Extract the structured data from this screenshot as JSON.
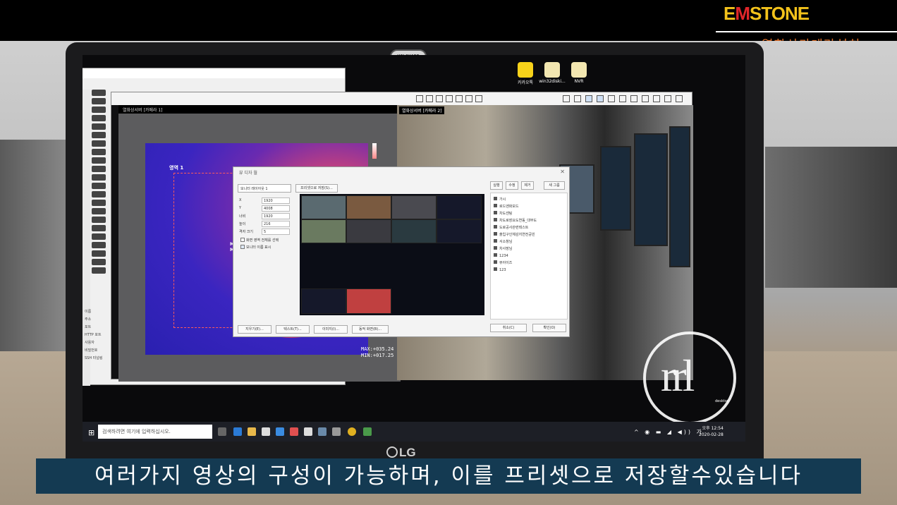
{
  "brand": {
    "name_e": "E",
    "name_m": "M",
    "name_rest": "STONE",
    "subtitle": "열화상카메라설치"
  },
  "laptop": {
    "brand": "LG",
    "webcam_label": "HOLGUARD"
  },
  "desktop_icons": [
    {
      "label": "카카오톡",
      "icon": "kakaotalk-icon",
      "color": "#f7d21a"
    },
    {
      "label": "win32diski...",
      "icon": "disk-image-icon",
      "color": "#f2e6b0"
    },
    {
      "label": "NVR",
      "icon": "nvr-doc-icon",
      "color": "#f2e6b0"
    }
  ],
  "back_window": {
    "props": [
      "이름",
      "주소",
      "포트",
      "HTTP 포트",
      "사용자",
      "비밀번호",
      "SSH 터널링"
    ]
  },
  "viewer": {
    "camera1_title": "열화상서버 [카메라 1]",
    "camera2_title": "열화상서버 [카메라 2]",
    "area_label": "영역 1",
    "ma_text": "MA",
    "mi_text": "MI",
    "max_text": "MAX:+035.24",
    "min_text": "MIN:+017.25"
  },
  "dialog": {
    "title": "뷰 디자 월",
    "monitor_select": "모니터 레이아웃 1",
    "save_preset_button": "프리셋으로 저장(S)...",
    "fields": [
      {
        "label": "X",
        "value": "1920"
      },
      {
        "label": "Y",
        "value": "4008"
      },
      {
        "label": "너비",
        "value": "1920"
      },
      {
        "label": "높이",
        "value": "216"
      },
      {
        "label": "격자 크기",
        "value": "5"
      }
    ],
    "checkbox1": "화면 영역 전체를 선택",
    "checkbox2": "모니터 이름 표시",
    "top_buttons": [
      "실행",
      "수정",
      "제거",
      "새 그룹"
    ],
    "presets": [
      "가시",
      "로드엔화모드",
      "차도센팅",
      "차도로장요도연동_대부도",
      "도로공사관련테스트",
      "출입구인체감지연전공빈",
      "서소창님",
      "차사장님",
      "1234",
      "뷰아이즈",
      "123"
    ],
    "bottom_buttons": [
      "지우기(E)...",
      "텍스트(T)...",
      "이미지(I)...",
      "동적 화면(B)..."
    ],
    "cancel": "취소(C)",
    "ok": "확인(O)"
  },
  "taskbar": {
    "search_placeholder": "검색하려면 여기에 입력하십시오.",
    "time": "오후 12:54",
    "date": "2020-02-28",
    "ime": "가"
  },
  "watermark": {
    "label": "desktop"
  },
  "caption": "여러가지 영상의 구성이 가능하며, 이를 프리셋으로 저장할수있습니다"
}
